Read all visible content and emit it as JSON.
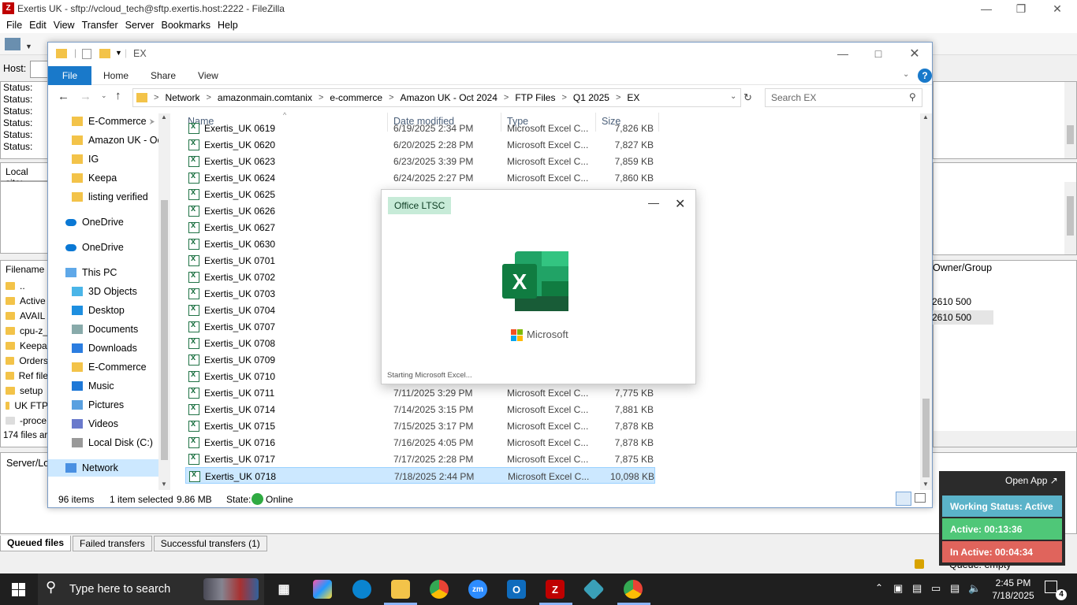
{
  "filezilla": {
    "title": "Exertis UK - sftp://vcloud_tech@sftp.exertis.host:2222 - FileZilla",
    "menu": [
      "File",
      "Edit",
      "View",
      "Transfer",
      "Server",
      "Bookmarks",
      "Help"
    ],
    "host_label": "Host:",
    "log_lines": [
      "Status:",
      "Status:",
      "Status:",
      "Status:",
      "Status:",
      "Status:"
    ],
    "local_site_label": "Local site:",
    "filename_header": "Filename",
    "owner_header": "Owner/Group",
    "local_files": [
      "..",
      "Active",
      "AVAIL",
      "cpu-z_",
      "Keepa",
      "Orders",
      "Ref file",
      "setup",
      "UK FTP",
      "-proce"
    ],
    "owner_values": [
      "2610 500",
      "2610 500"
    ],
    "files_count": "174 files ar",
    "queue_header": "Server/Loc",
    "tabs": [
      "Queued files",
      "Failed transfers",
      "Successful transfers (1)"
    ],
    "queue_status": "Queue: empty"
  },
  "explorer": {
    "title": "EX",
    "ribbon": {
      "file": "File",
      "tabs": [
        "Home",
        "Share",
        "View"
      ]
    },
    "breadcrumb": [
      "Network",
      "amazonmain.comtanix",
      "e-commerce",
      "Amazon UK - Oct 2024",
      "FTP Files",
      "Q1 2025",
      "EX"
    ],
    "search_placeholder": "Search EX",
    "nav": [
      {
        "label": "E-Commerce",
        "icon": "folder-icon"
      },
      {
        "label": "Amazon UK - Oc",
        "icon": "folder-icon"
      },
      {
        "label": "IG",
        "icon": "folder-icon"
      },
      {
        "label": "Keepa",
        "icon": "folder-icon"
      },
      {
        "label": "listing verified",
        "icon": "folder-icon"
      },
      {
        "label": "OneDrive",
        "icon": "onedrive-icon"
      },
      {
        "label": "OneDrive",
        "icon": "onedrive-icon"
      },
      {
        "label": "This PC",
        "icon": "pc-icon"
      },
      {
        "label": "3D Objects",
        "icon": "3d-objects-icon"
      },
      {
        "label": "Desktop",
        "icon": "desktop-icon"
      },
      {
        "label": "Documents",
        "icon": "documents-icon"
      },
      {
        "label": "Downloads",
        "icon": "downloads-icon"
      },
      {
        "label": "E-Commerce",
        "icon": "folder-icon"
      },
      {
        "label": "Music",
        "icon": "music-icon"
      },
      {
        "label": "Pictures",
        "icon": "pictures-icon"
      },
      {
        "label": "Videos",
        "icon": "videos-icon"
      },
      {
        "label": "Local Disk (C:)",
        "icon": "disk-icon"
      },
      {
        "label": "Network",
        "icon": "network-icon"
      }
    ],
    "columns": [
      "Name",
      "Date modified",
      "Type",
      "Size"
    ],
    "files": [
      {
        "name": "Exertis_UK 0619",
        "date": "6/19/2025 2:34 PM",
        "type": "Microsoft Excel C...",
        "size": "7,826 KB"
      },
      {
        "name": "Exertis_UK 0620",
        "date": "6/20/2025 2:28 PM",
        "type": "Microsoft Excel C...",
        "size": "7,827 KB"
      },
      {
        "name": "Exertis_UK 0623",
        "date": "6/23/2025 3:39 PM",
        "type": "Microsoft Excel C...",
        "size": "7,859 KB"
      },
      {
        "name": "Exertis_UK 0624",
        "date": "6/24/2025 2:27 PM",
        "type": "Microsoft Excel C...",
        "size": "7,860 KB"
      },
      {
        "name": "Exertis_UK 0625",
        "date": "",
        "type": "",
        "size": ""
      },
      {
        "name": "Exertis_UK 0626",
        "date": "",
        "type": "",
        "size": ""
      },
      {
        "name": "Exertis_UK 0627",
        "date": "",
        "type": "",
        "size": ""
      },
      {
        "name": "Exertis_UK 0630",
        "date": "",
        "type": "",
        "size": ""
      },
      {
        "name": "Exertis_UK 0701",
        "date": "",
        "type": "",
        "size": ""
      },
      {
        "name": "Exertis_UK 0702",
        "date": "",
        "type": "",
        "size": ""
      },
      {
        "name": "Exertis_UK 0703",
        "date": "",
        "type": "",
        "size": ""
      },
      {
        "name": "Exertis_UK 0704",
        "date": "",
        "type": "",
        "size": ""
      },
      {
        "name": "Exertis_UK 0707",
        "date": "",
        "type": "",
        "size": ""
      },
      {
        "name": "Exertis_UK 0708",
        "date": "",
        "type": "",
        "size": ""
      },
      {
        "name": "Exertis_UK 0709",
        "date": "",
        "type": "",
        "size": ""
      },
      {
        "name": "Exertis_UK 0710",
        "date": "",
        "type": "",
        "size": ""
      },
      {
        "name": "Exertis_UK 0711",
        "date": "7/11/2025 3:29 PM",
        "type": "Microsoft Excel C...",
        "size": "7,775 KB"
      },
      {
        "name": "Exertis_UK 0714",
        "date": "7/14/2025 3:15 PM",
        "type": "Microsoft Excel C...",
        "size": "7,881 KB"
      },
      {
        "name": "Exertis_UK 0715",
        "date": "7/15/2025 3:17 PM",
        "type": "Microsoft Excel C...",
        "size": "7,878 KB"
      },
      {
        "name": "Exertis_UK 0716",
        "date": "7/16/2025 4:05 PM",
        "type": "Microsoft Excel C...",
        "size": "7,878 KB"
      },
      {
        "name": "Exertis_UK 0717",
        "date": "7/17/2025 2:28 PM",
        "type": "Microsoft Excel C...",
        "size": "7,875 KB"
      },
      {
        "name": "Exertis_UK 0718",
        "date": "7/18/2025 2:44 PM",
        "type": "Microsoft Excel C...",
        "size": "10,098 KB",
        "selected": true
      }
    ],
    "status": {
      "count": "96 items",
      "selected": "1 item selected",
      "size": "9.86 MB",
      "state_label": "State:",
      "state_value": "Online"
    }
  },
  "splash": {
    "badge": "Office LTSC",
    "brand": "Microsoft",
    "status": "Starting Microsoft Excel..."
  },
  "widget": {
    "open_app": "Open App ↗",
    "working": "Working Status: Active",
    "active": "Active: 00:13:36",
    "inactive": "In Active: 00:04:34"
  },
  "taskbar": {
    "search_placeholder": "Type here to search",
    "time": "2:45 PM",
    "date": "7/18/2025",
    "notif_count": "4"
  }
}
